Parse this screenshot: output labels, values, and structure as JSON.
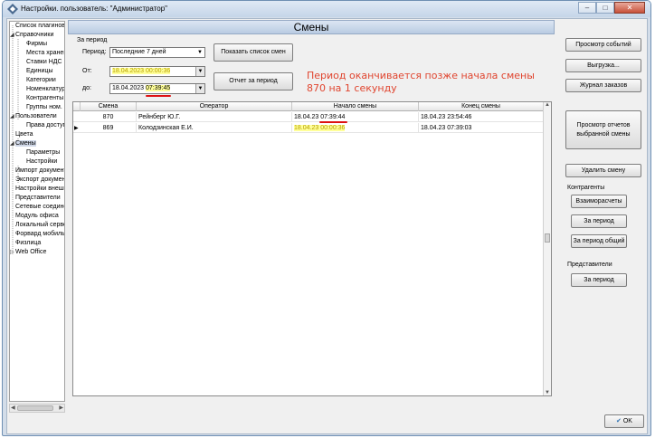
{
  "window": {
    "title": "Настройки. пользователь: \"Администратор\"",
    "min_label": "–",
    "max_label": "□",
    "close_label": "✕"
  },
  "tree": {
    "items": [
      {
        "label": "Список плагинов",
        "indent": 0,
        "expander": ""
      },
      {
        "label": "Справочники",
        "indent": 0,
        "expander": "◢"
      },
      {
        "label": "Фирмы",
        "indent": 2,
        "expander": ""
      },
      {
        "label": "Места хранения",
        "indent": 2,
        "expander": ""
      },
      {
        "label": "Ставки НДС",
        "indent": 2,
        "expander": ""
      },
      {
        "label": "Единицы",
        "indent": 2,
        "expander": ""
      },
      {
        "label": "Категории",
        "indent": 2,
        "expander": ""
      },
      {
        "label": "Номенклатура",
        "indent": 2,
        "expander": ""
      },
      {
        "label": "Контрагенты",
        "indent": 2,
        "expander": ""
      },
      {
        "label": "Группы ном.",
        "indent": 2,
        "expander": ""
      },
      {
        "label": "Пользователи",
        "indent": 0,
        "expander": "◢"
      },
      {
        "label": "Права доступа",
        "indent": 2,
        "expander": ""
      },
      {
        "label": "Цвета",
        "indent": 0,
        "expander": ""
      },
      {
        "label": "Смены",
        "indent": 0,
        "expander": "◢"
      },
      {
        "label": "Параметры",
        "indent": 2,
        "expander": ""
      },
      {
        "label": "Настройки",
        "indent": 2,
        "expander": ""
      },
      {
        "label": "Импорт документов",
        "indent": 0,
        "expander": ""
      },
      {
        "label": "Экспорт документов",
        "indent": 0,
        "expander": ""
      },
      {
        "label": "Настройки внешние",
        "indent": 0,
        "expander": ""
      },
      {
        "label": "Представители",
        "indent": 0,
        "expander": ""
      },
      {
        "label": "Сетевые соединения",
        "indent": 0,
        "expander": ""
      },
      {
        "label": "Модуль офиса",
        "indent": 0,
        "expander": ""
      },
      {
        "label": "Локальный сервер",
        "indent": 0,
        "expander": ""
      },
      {
        "label": "Форвард мобильный",
        "indent": 0,
        "expander": ""
      },
      {
        "label": "Физлица",
        "indent": 0,
        "expander": ""
      },
      {
        "label": "Web Office",
        "indent": 0,
        "expander": "▷"
      }
    ]
  },
  "main": {
    "header": "Смены",
    "period_group": "За период",
    "period_label": "Период:",
    "period_value": "Последние 7 дней",
    "from_label": "От:",
    "from_value": "18.04.2023 00:00:36",
    "to_label": "до:",
    "to_value_date": "18.04.2023 ",
    "to_value_time": "07:39:45",
    "show_list_button": "Показать список смен",
    "report_button": "Отчет за период",
    "note": "Период оканчивается позже начала смены 870 на 1 секунду"
  },
  "grid": {
    "columns": [
      "Смена",
      "Оператор",
      "Начало смены",
      "Конец смены"
    ],
    "rows": [
      {
        "shift": "870",
        "operator": "Рейнберг Ю.Г.",
        "start_date": "18.04.23 ",
        "start_time": "07:39:44",
        "end": "18.04.23 23:54:46"
      },
      {
        "shift": "869",
        "operator": "Колодзинская Е.И.",
        "start_date": "18.04.23 00:00:36",
        "start_time": "",
        "end": "18.04.23 07:39:03"
      }
    ]
  },
  "right": {
    "events_button": "Просмотр событий",
    "export_button": "Выгрузка...",
    "orders_button": "Журнал заказов",
    "view_reports_button": "Просмотр отчетов выбранной смены",
    "delete_shift_button": "Удалить смену",
    "contragents_title": "Контрагенты",
    "settlements_button": "Взаиморасчеты",
    "period_button": "За период",
    "period_total_button": "За период общий",
    "representatives_title": "Представители",
    "rep_period_button": "За период"
  },
  "footer": {
    "ok_button": "OK"
  },
  "colors": {
    "highlight": "#ffff99",
    "note_red": "#e0452f",
    "underline": "#dd1111"
  }
}
